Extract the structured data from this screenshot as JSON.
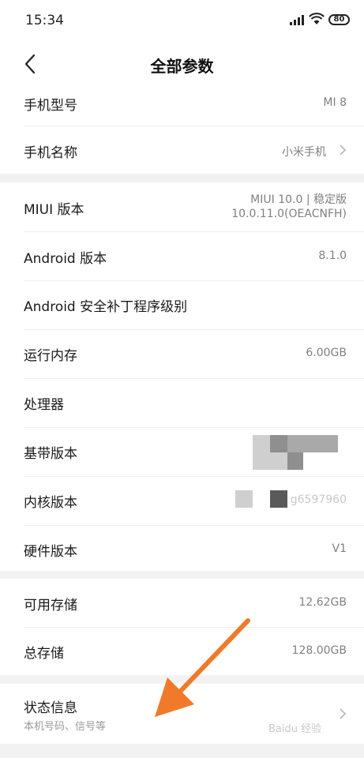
{
  "status_bar": {
    "time": "15:34",
    "battery": "80"
  },
  "header": {
    "title": "全部参数"
  },
  "device_group": [
    {
      "label": "手机型号",
      "value": "MI 8"
    },
    {
      "label": "手机名称",
      "value": "小米手机"
    }
  ],
  "system_group": [
    {
      "label": "MIUI 版本",
      "value_line1": "MIUI 10.0 | 稳定版",
      "value_line2": "10.0.11.0(OEACNFH)"
    },
    {
      "label": "Android 版本",
      "value": "8.1.0"
    },
    {
      "label": "Android 安全补丁程序级别",
      "value": ""
    },
    {
      "label": "运行内存",
      "value": "6.00GB"
    },
    {
      "label": "处理器",
      "value": ""
    },
    {
      "label": "基带版本",
      "value": ""
    },
    {
      "label": "内核版本",
      "value": "g6597960"
    },
    {
      "label": "硬件版本",
      "value": "V1"
    }
  ],
  "storage_group": [
    {
      "label": "可用存储",
      "value": "12.62GB"
    },
    {
      "label": "总存储",
      "value": "128.00GB"
    }
  ],
  "status_info": {
    "label": "状态信息",
    "subtitle": "本机号码、信号等"
  },
  "watermark": "Baidu 经验",
  "colors": {
    "annotation_arrow": "#f07a2a",
    "background": "#f2f2f2",
    "secondary_text": "#808080"
  }
}
